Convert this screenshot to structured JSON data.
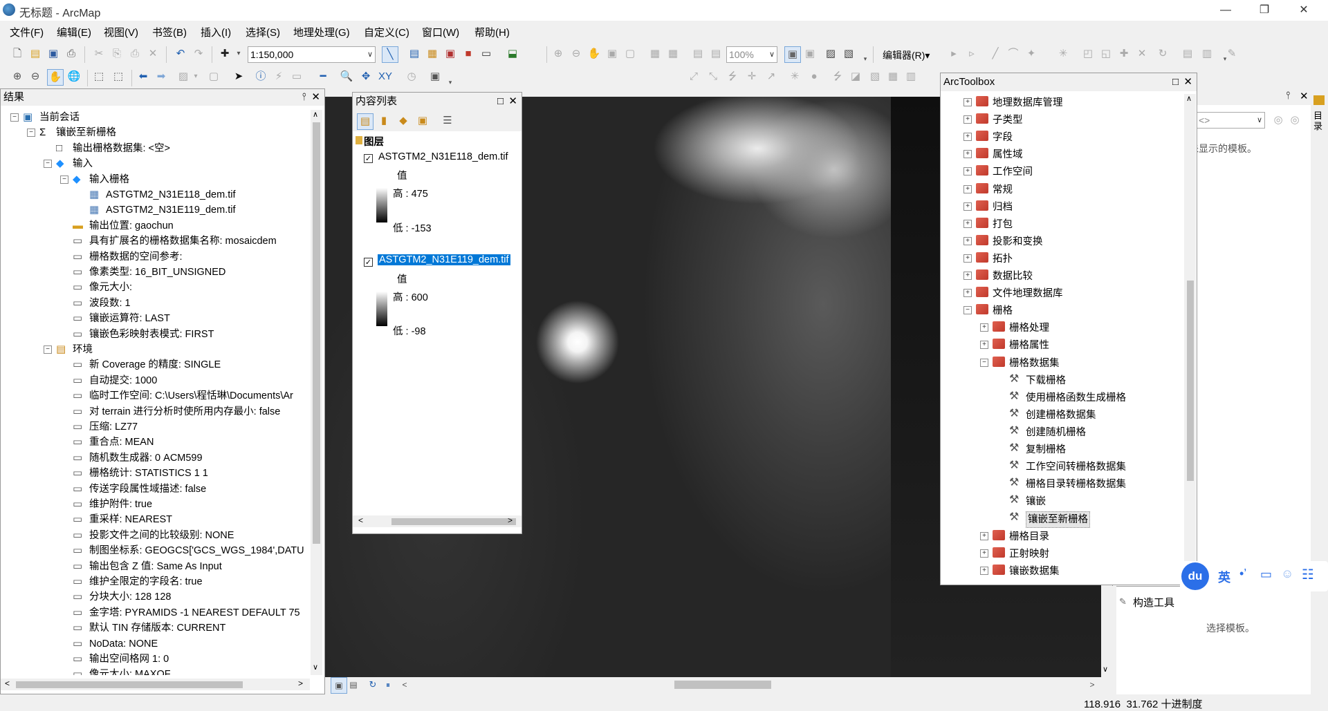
{
  "window": {
    "title": "无标题 - ArcMap"
  },
  "menu": [
    "文件(F)",
    "编辑(E)",
    "视图(V)",
    "书签(B)",
    "插入(I)",
    "选择(S)",
    "地理处理(G)",
    "自定义(C)",
    "窗口(W)",
    "帮助(H)"
  ],
  "toolbar": {
    "scale": "1:150,000",
    "zoom": "100%",
    "editor": "编辑器(R)▾"
  },
  "results": {
    "title": "结果",
    "rows": [
      {
        "level": 0,
        "exp": "−",
        "icon": "session",
        "text": "当前会话"
      },
      {
        "level": 1,
        "exp": "−",
        "icon": "sigma",
        "text": "镶嵌至新栅格"
      },
      {
        "level": 2,
        "exp": "",
        "icon": "box",
        "text": "输出栅格数据集: <空>"
      },
      {
        "level": 2,
        "exp": "−",
        "icon": "diamond",
        "text": "输入"
      },
      {
        "level": 3,
        "exp": "−",
        "icon": "diamond",
        "text": "输入栅格"
      },
      {
        "level": 4,
        "exp": "",
        "icon": "raster",
        "text": "ASTGTM2_N31E118_dem.tif"
      },
      {
        "level": 4,
        "exp": "",
        "icon": "raster",
        "text": "ASTGTM2_N31E119_dem.tif"
      },
      {
        "level": 3,
        "exp": "",
        "icon": "folder",
        "text": "输出位置: gaochun"
      },
      {
        "level": 3,
        "exp": "",
        "icon": "param",
        "text": "具有扩展名的栅格数据集名称: mosaicdem"
      },
      {
        "level": 3,
        "exp": "",
        "icon": "param",
        "text": "栅格数据的空间参考:"
      },
      {
        "level": 3,
        "exp": "",
        "icon": "param",
        "text": "像素类型: 16_BIT_UNSIGNED"
      },
      {
        "level": 3,
        "exp": "",
        "icon": "param",
        "text": "像元大小:"
      },
      {
        "level": 3,
        "exp": "",
        "icon": "param",
        "text": "波段数: 1"
      },
      {
        "level": 3,
        "exp": "",
        "icon": "param",
        "text": "镶嵌运算符: LAST"
      },
      {
        "level": 3,
        "exp": "",
        "icon": "param",
        "text": "镶嵌色彩映射表模式: FIRST"
      },
      {
        "level": 2,
        "exp": "−",
        "icon": "env",
        "text": "环境"
      },
      {
        "level": 3,
        "exp": "",
        "icon": "param",
        "text": "新 Coverage 的精度: SINGLE"
      },
      {
        "level": 3,
        "exp": "",
        "icon": "param",
        "text": "自动提交: 1000"
      },
      {
        "level": 3,
        "exp": "",
        "icon": "param",
        "text": "临时工作空间: C:\\Users\\程恬琳\\Documents\\Ar"
      },
      {
        "level": 3,
        "exp": "",
        "icon": "param",
        "text": "对 terrain 进行分析时使所用内存最小: false"
      },
      {
        "level": 3,
        "exp": "",
        "icon": "param",
        "text": "压缩: LZ77"
      },
      {
        "level": 3,
        "exp": "",
        "icon": "param",
        "text": "重合点: MEAN"
      },
      {
        "level": 3,
        "exp": "",
        "icon": "param",
        "text": "随机数生成器: 0 ACM599"
      },
      {
        "level": 3,
        "exp": "",
        "icon": "param",
        "text": "栅格统计: STATISTICS 1 1"
      },
      {
        "level": 3,
        "exp": "",
        "icon": "param",
        "text": "传送字段属性域描述: false"
      },
      {
        "level": 3,
        "exp": "",
        "icon": "param",
        "text": "维护附件: true"
      },
      {
        "level": 3,
        "exp": "",
        "icon": "param",
        "text": "重采样: NEAREST"
      },
      {
        "level": 3,
        "exp": "",
        "icon": "param",
        "text": "投影文件之间的比较级别: NONE"
      },
      {
        "level": 3,
        "exp": "",
        "icon": "param",
        "text": "制图坐标系: GEOGCS['GCS_WGS_1984',DATU"
      },
      {
        "level": 3,
        "exp": "",
        "icon": "param",
        "text": "输出包含 Z 值: Same As Input"
      },
      {
        "level": 3,
        "exp": "",
        "icon": "param",
        "text": "维护全限定的字段名: true"
      },
      {
        "level": 3,
        "exp": "",
        "icon": "param",
        "text": "分块大小: 128 128"
      },
      {
        "level": 3,
        "exp": "",
        "icon": "param",
        "text": "金字塔: PYRAMIDS -1 NEAREST DEFAULT 75"
      },
      {
        "level": 3,
        "exp": "",
        "icon": "param",
        "text": "默认 TIN 存储版本: CURRENT"
      },
      {
        "level": 3,
        "exp": "",
        "icon": "param",
        "text": "NoData: NONE"
      },
      {
        "level": 3,
        "exp": "",
        "icon": "param",
        "text": "输出空间格网 1: 0"
      },
      {
        "level": 3,
        "exp": "",
        "icon": "param",
        "text": "像元大小: MAXOF"
      }
    ]
  },
  "toc": {
    "title": "内容列表",
    "group": "图层",
    "layers": [
      {
        "name": "ASTGTM2_N31E118_dem.tif",
        "value_label": "值",
        "high": "高 : 475",
        "low": "低 : -153",
        "selected": false
      },
      {
        "name": "ASTGTM2_N31E119_dem.tif",
        "value_label": "值",
        "high": "高 : 600",
        "low": "低 : -98",
        "selected": true
      }
    ]
  },
  "toolbox": {
    "title": "ArcToolbox",
    "rows": [
      {
        "level": 0,
        "exp": "+",
        "type": "box",
        "text": "地理数据库管理"
      },
      {
        "level": 0,
        "exp": "+",
        "type": "box",
        "text": "子类型"
      },
      {
        "level": 0,
        "exp": "+",
        "type": "box",
        "text": "字段"
      },
      {
        "level": 0,
        "exp": "+",
        "type": "box",
        "text": "属性域"
      },
      {
        "level": 0,
        "exp": "+",
        "type": "box",
        "text": "工作空间"
      },
      {
        "level": 0,
        "exp": "+",
        "type": "box",
        "text": "常规"
      },
      {
        "level": 0,
        "exp": "+",
        "type": "box",
        "text": "归档"
      },
      {
        "level": 0,
        "exp": "+",
        "type": "box",
        "text": "打包"
      },
      {
        "level": 0,
        "exp": "+",
        "type": "box",
        "text": "投影和变换"
      },
      {
        "level": 0,
        "exp": "+",
        "type": "box",
        "text": "拓扑"
      },
      {
        "level": 0,
        "exp": "+",
        "type": "box",
        "text": "数据比较"
      },
      {
        "level": 0,
        "exp": "+",
        "type": "box",
        "text": "文件地理数据库"
      },
      {
        "level": 0,
        "exp": "−",
        "type": "box",
        "text": "栅格"
      },
      {
        "level": 1,
        "exp": "+",
        "type": "box",
        "text": "栅格处理"
      },
      {
        "level": 1,
        "exp": "+",
        "type": "box",
        "text": "栅格属性"
      },
      {
        "level": 1,
        "exp": "−",
        "type": "box",
        "text": "栅格数据集"
      },
      {
        "level": 2,
        "exp": "",
        "type": "tool",
        "text": "下载栅格"
      },
      {
        "level": 2,
        "exp": "",
        "type": "tool",
        "text": "使用栅格函数生成栅格"
      },
      {
        "level": 2,
        "exp": "",
        "type": "tool",
        "text": "创建栅格数据集"
      },
      {
        "level": 2,
        "exp": "",
        "type": "tool",
        "text": "创建随机栅格"
      },
      {
        "level": 2,
        "exp": "",
        "type": "tool",
        "text": "复制栅格"
      },
      {
        "level": 2,
        "exp": "",
        "type": "tool",
        "text": "工作空间转栅格数据集"
      },
      {
        "level": 2,
        "exp": "",
        "type": "tool",
        "text": "栅格目录转栅格数据集"
      },
      {
        "level": 2,
        "exp": "",
        "type": "tool",
        "text": "镶嵌"
      },
      {
        "level": 2,
        "exp": "",
        "type": "tool",
        "text": "镶嵌至新栅格",
        "highlight": true
      },
      {
        "level": 1,
        "exp": "+",
        "type": "box",
        "text": "栅格目录"
      },
      {
        "level": 1,
        "exp": "+",
        "type": "box",
        "text": "正射映射"
      },
      {
        "level": 1,
        "exp": "+",
        "type": "box",
        "text": "镶嵌数据集"
      }
    ]
  },
  "create_features": {
    "hint": "未显示的模板。",
    "dropdown": "<>",
    "tab_label": "目录"
  },
  "construct_tools": {
    "title": "构造工具",
    "hint": "选择模板。"
  },
  "ime": {
    "logo": "du",
    "lang": "英"
  },
  "status": {
    "coords": "118.916  31.762 十进制度"
  },
  "colors": {
    "selection": "#0078d7",
    "toolbox_icon": "#c0392b"
  }
}
